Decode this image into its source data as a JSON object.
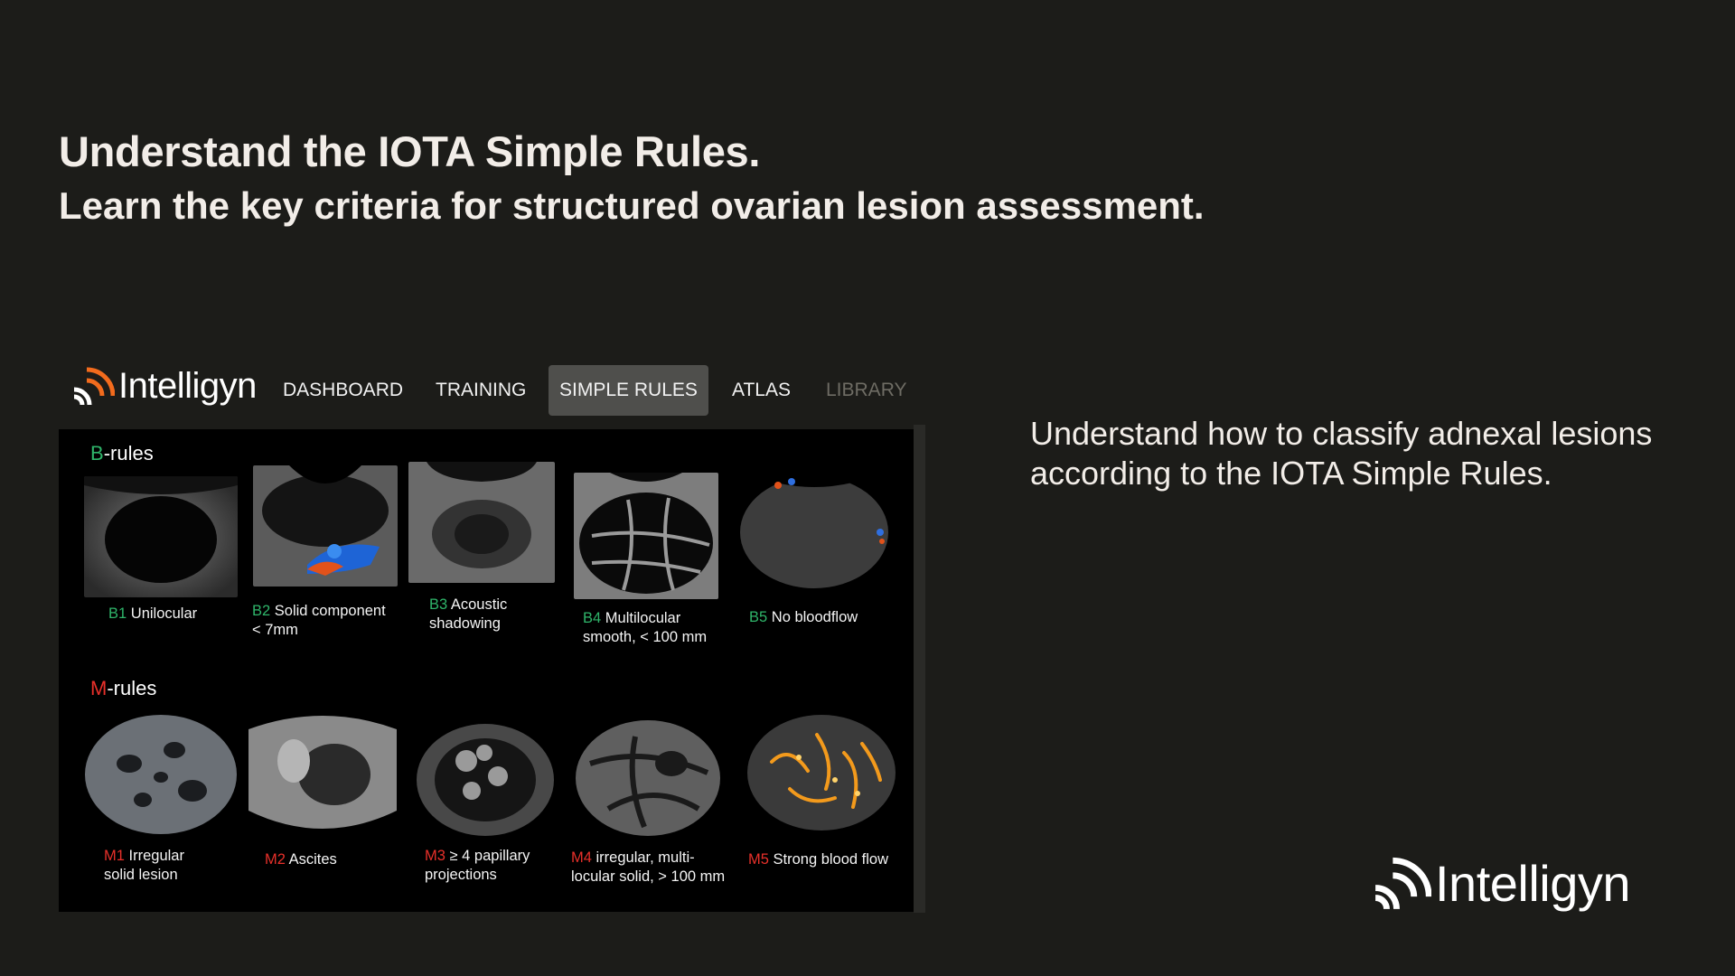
{
  "headline": "Understand the IOTA Simple Rules.",
  "subheadline": "Learn the key criteria for structured ovarian lesion assessment.",
  "description": "Understand how to classify adnexal lesions according to the IOTA Simple Rules.",
  "brand": {
    "name": "Intelligyn",
    "accent": "#f26b1d"
  },
  "nav": {
    "items": [
      {
        "label": "DASHBOARD"
      },
      {
        "label": "TRAINING"
      },
      {
        "label": "SIMPLE RULES"
      },
      {
        "label": "ATLAS"
      },
      {
        "label": "LIBRARY"
      }
    ]
  },
  "b_rules": {
    "title_prefix": "B",
    "title_suffix": "-rules",
    "items": [
      {
        "code": "B1",
        "label": "Unilocular"
      },
      {
        "code": "B2",
        "label": "Solid component",
        "label2": "< 7mm"
      },
      {
        "code": "B3",
        "label": "Acoustic",
        "label2": "shadowing"
      },
      {
        "code": "B4",
        "label": "Multilocular",
        "label2": "smooth, < 100 mm"
      },
      {
        "code": "B5",
        "label": "No bloodflow"
      }
    ]
  },
  "m_rules": {
    "title_prefix": "M",
    "title_suffix": "-rules",
    "items": [
      {
        "code": "M1",
        "label": "Irregular",
        "label2": "solid lesion"
      },
      {
        "code": "M2",
        "label": "Ascites"
      },
      {
        "code": "M3",
        "label": "≥ 4 papillary",
        "label2": "projections"
      },
      {
        "code": "M4",
        "label": "irregular, multi-",
        "label2": "locular solid, > 100 mm"
      },
      {
        "code": "M5",
        "label": "Strong blood flow"
      }
    ]
  },
  "colors": {
    "background": "#1c1c19",
    "b_green": "#2fb56a",
    "m_red": "#e8302a",
    "active_tab": "#4f4f4c"
  }
}
